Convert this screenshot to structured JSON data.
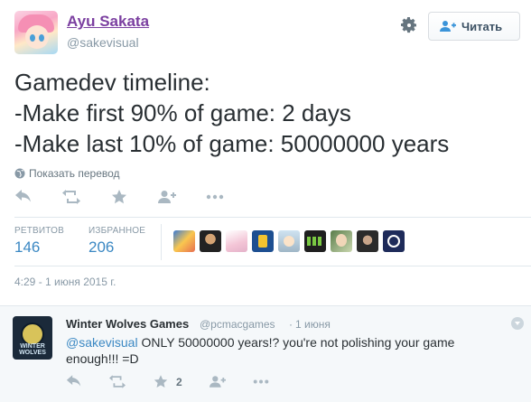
{
  "header": {
    "display_name": "Ayu Sakata",
    "handle": "@sakevisual",
    "follow_label": "Читать"
  },
  "tweet": {
    "text_lines": [
      "Gamedev timeline:",
      "-Make first 90% of game: 2 days",
      "-Make last 10% of game: 50000000 years"
    ],
    "translate_label": "Показать перевод",
    "stats": {
      "retweets_label": "РЕТВИТОВ",
      "retweets_count": "146",
      "favorites_label": "ИЗБРАННОЕ",
      "favorites_count": "206"
    },
    "timestamp": "4:29 - 1 июня 2015 г.",
    "icons": [
      "reply-icon",
      "retweet-icon",
      "favorite-star-icon",
      "follow-user-icon",
      "more-icon"
    ],
    "favoriter_avatars": 9
  },
  "reply": {
    "display_name": "Winter Wolves Games",
    "handle": "@pcmacgames",
    "dot": "·",
    "time": "1 июня",
    "mention": "@sakevisual",
    "text": " ONLY 50000000 years!? you're not polishing your game enough!!! =D",
    "avatar_text": "WINTER WOLVES",
    "favorite_count": "2"
  },
  "colors": {
    "link": "#3b88c3",
    "name_link": "#7b3fa0",
    "muted": "#8899a6",
    "icon": "#aab8c2"
  }
}
